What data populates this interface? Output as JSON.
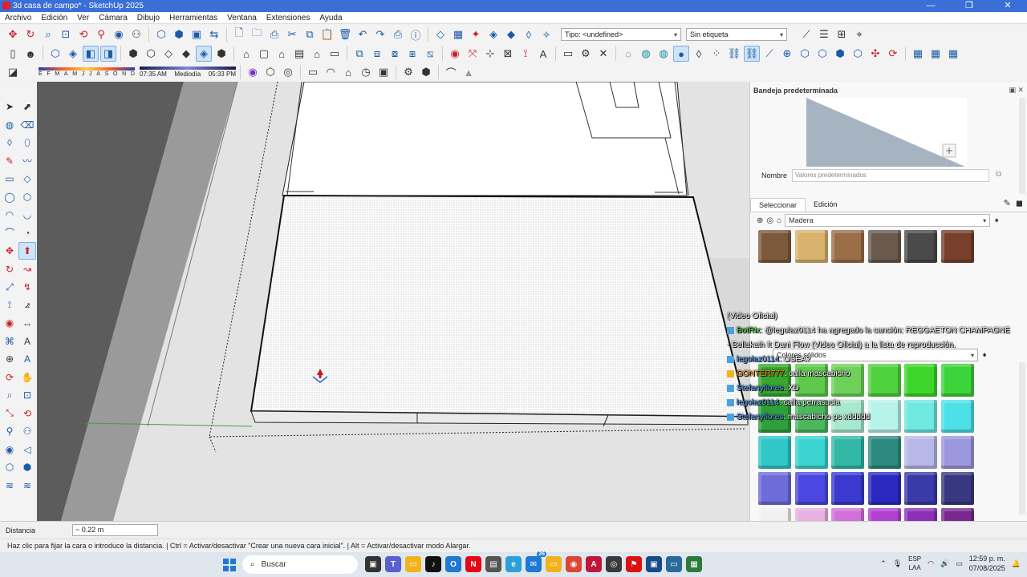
{
  "window": {
    "title": "3d casa de campo* - SketchUp 2025",
    "controls": [
      "—",
      "❐",
      "✕"
    ]
  },
  "menu": [
    "Archivo",
    "Edición",
    "Ver",
    "Cámara",
    "Dibujo",
    "Herramientas",
    "Ventana",
    "Extensiones",
    "Ayuda"
  ],
  "toolbar": {
    "type_dropdown": "Tipo: <undefined>",
    "tag_dropdown": "Sin etiqueta",
    "shadow_months": [
      "E",
      "F",
      "M",
      "A",
      "M",
      "J",
      "J",
      "A",
      "S",
      "O",
      "N",
      "D"
    ],
    "time_start": "07:35 AM",
    "time_mid": "Mediodía",
    "time_end": "05:33 PM"
  },
  "tray": {
    "title": "Bandeja predeterminada",
    "controls": "▣ ✕",
    "name_label": "Nombre",
    "name_placeholder": "Valores predeterminados",
    "tab_select": "Seleccionar",
    "tab_edit": "Edición",
    "library": "Madera",
    "library2": "Colores sólidos",
    "wood_colors": [
      "#7b5a3c",
      "#d9b26e",
      "#9a6f48",
      "#6a5a4e",
      "#4a4a4a",
      "#7a3e2c"
    ],
    "solid_colors": [
      "#39a82e",
      "#5ec94c",
      "#6fd15b",
      "#4fd13e",
      "#3ed62a",
      "#3bd43a",
      "#2fa039",
      "#4bb85e",
      "#a8e8d0",
      "#b8f3ea",
      "#6ee8e0",
      "#4de0e6",
      "#31c6c8",
      "#3cd4d0",
      "#33b8a8",
      "#2e8a80",
      "#b8b8e8",
      "#9b98e0",
      "#6e6cd8",
      "#4a48e0",
      "#3a3ad0",
      "#2a2ac0",
      "#3a3aa8",
      "#383880",
      "#f0f0f0",
      "#e8b0e0",
      "#d070d8",
      "#b040d0",
      "#8a30b8",
      "#7a2890"
    ]
  },
  "chat": [
    {
      "kind": "plain",
      "text": "(Video Oficial)"
    },
    {
      "kind": "msg",
      "user": "BotRix",
      "ucolor": "green",
      "text": ": @legolaz0114 ha agregado la canción: REGGAETON CHAMPAGNE"
    },
    {
      "kind": "plain",
      "text": "- Bellakath ft Dani Flow (Video Oficial) a la lista de reproducción."
    },
    {
      "kind": "msg",
      "user": "legolaz0114",
      "ucolor": "blue",
      "text": ": OSEA?"
    },
    {
      "kind": "msg",
      "user": "GONTER777",
      "ucolor": "orange",
      "text": ": calla mascabicho"
    },
    {
      "kind": "msg",
      "user": "Stefanyflores",
      "ucolor": "blue",
      "text": ": XD"
    },
    {
      "kind": "msg",
      "user": "legolaz0114",
      "ucolor": "blue",
      "text": ": calla perrasucia"
    },
    {
      "kind": "msg",
      "user": "Stefanyflores",
      "ucolor": "blue",
      "text": ": mascabicho ps xddddd"
    }
  ],
  "measure": {
    "label": "Distancia",
    "value": "~ 0.22 m"
  },
  "status": {
    "text": "Haz clic para fijar la cara o introduce la distancia. | Ctrl = Activar/desactivar \"Crear una nueva cara inicial\". | Alt = Activar/desactivar modo Alargar."
  },
  "taskbar": {
    "search_placeholder": "Buscar",
    "badge_count": "26",
    "lang_line1": "ESP",
    "lang_line2": "LAA",
    "time": "12:59 p. m.",
    "date": "07/08/2025"
  }
}
